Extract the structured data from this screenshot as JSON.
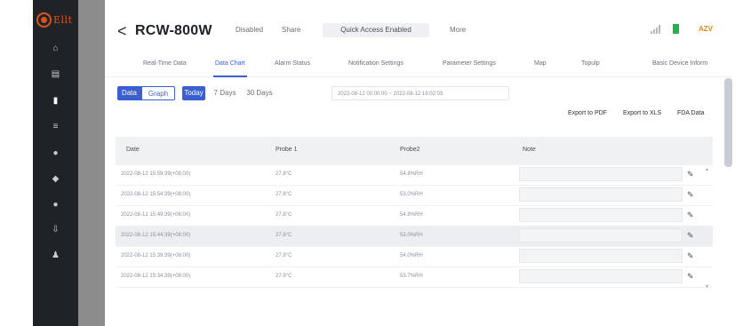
{
  "brand": {
    "logo_text": "Ellt",
    "accent": "#d8551f"
  },
  "sidebar": {
    "items": [
      {
        "icon": "home-icon",
        "glyph": "⌂"
      },
      {
        "icon": "list-icon",
        "glyph": "▤"
      },
      {
        "icon": "device-icon",
        "glyph": "▮"
      },
      {
        "icon": "menu-icon",
        "glyph": "≡"
      },
      {
        "icon": "alarm-icon",
        "glyph": "●"
      },
      {
        "icon": "settings-icon",
        "glyph": "◆"
      },
      {
        "icon": "location-icon",
        "glyph": "●"
      },
      {
        "icon": "download-icon",
        "glyph": "⇩"
      },
      {
        "icon": "user-icon",
        "glyph": "♟"
      }
    ]
  },
  "header": {
    "back": "<",
    "device_name": "RCW-800W",
    "disabled": "Disabled",
    "share": "Share",
    "quick_access": "Quick Access Enabled",
    "more": "More",
    "voltage": "AZV"
  },
  "tabs": [
    {
      "label": "Real-Time Data"
    },
    {
      "label": "Data Chart"
    },
    {
      "label": "Alarm Status"
    },
    {
      "label": "Notification Settings"
    },
    {
      "label": "Parameter Settings"
    },
    {
      "label": "Map"
    },
    {
      "label": "Topulp"
    },
    {
      "label": "Basic Device Inform"
    }
  ],
  "toolbar": {
    "data": "Data",
    "graph": "Graph",
    "today": "Today",
    "days7": "7 Days",
    "days30": "30 Days",
    "range": "2022-08-12 00:00:00 ~ 2022-08-12 19:02:03"
  },
  "actions": {
    "export_pdf": "Export to PDF",
    "export_xls": "Export to XLS",
    "fda": "FDA Data"
  },
  "table": {
    "headers": [
      "Date",
      "Probe 1",
      "Probe2",
      "Note"
    ],
    "rows": [
      {
        "date": "2022-08-12 15:59:39(+08:00)",
        "probe1": "27.8°C",
        "probe2": "54.8%RH"
      },
      {
        "date": "2022-08-12 15:54:39(+08:00)",
        "probe1": "27.8°C",
        "probe2": "53.0%RH"
      },
      {
        "date": "2022-08-12 15:49:39(+08:00)",
        "probe1": "27.8°C",
        "probe2": "54.8%RH"
      },
      {
        "date": "2022-08-12 15:44:39(+08:00)",
        "probe1": "27.8°C",
        "probe2": "53.0%RH"
      },
      {
        "date": "2022-08-12 15:39:39(+08:00)",
        "probe1": "27.8°C",
        "probe2": "54.0%RH"
      },
      {
        "date": "2022-08-12 15:34:39(+08:00)",
        "probe1": "27.9°C",
        "probe2": "53.7%RH"
      }
    ],
    "edit_glyph": "✎"
  }
}
